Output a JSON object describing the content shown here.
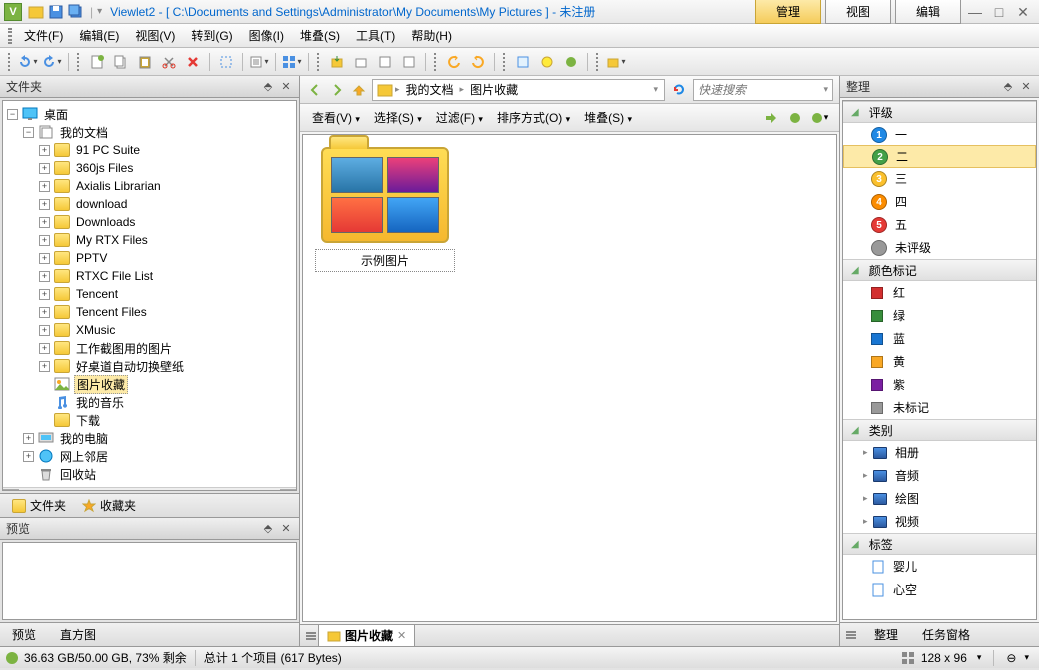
{
  "title": "Viewlet2 - [ C:\\Documents and Settings\\Administrator\\My Documents\\My Pictures ] - 未注册",
  "header_tabs": {
    "manage": "管理",
    "view": "视图",
    "edit": "编辑"
  },
  "menus": {
    "file": "文件(F)",
    "edit": "编辑(E)",
    "view": "视图(V)",
    "goto": "转到(G)",
    "image": "图像(I)",
    "stack": "堆叠(S)",
    "tools": "工具(T)",
    "help": "帮助(H)"
  },
  "panels": {
    "folders": "文件夹",
    "preview": "预览",
    "organize": "整理"
  },
  "tree": {
    "root": "桌面",
    "mydocs": "我的文档",
    "children": [
      "91 PC Suite",
      "360js Files",
      "Axialis Librarian",
      "download",
      "Downloads",
      "My RTX Files",
      "PPTV",
      "RTXC File List",
      "Tencent",
      "Tencent Files",
      "XMusic",
      "工作截图用的图片",
      "好桌道自动切换壁纸",
      "图片收藏",
      "我的音乐",
      "下载"
    ],
    "mycomputer": "我的电脑",
    "network": "网上邻居",
    "recycle": "回收站"
  },
  "left_tabs": {
    "folders": "文件夹",
    "favorites": "收藏夹"
  },
  "breadcrumb": {
    "mydocs": "我的文档",
    "pictures": "图片收藏"
  },
  "search_placeholder": "快速搜索",
  "view_menu": {
    "view": "查看(V)",
    "select": "选择(S)",
    "filter": "过滤(F)",
    "sort": "排序方式(O)",
    "stack": "堆叠(S)"
  },
  "file_item": "示例图片",
  "organize": {
    "rating": {
      "title": "评级",
      "items": [
        "一",
        "二",
        "三",
        "四",
        "五"
      ],
      "none": "未评级"
    },
    "color": {
      "title": "颜色标记",
      "items": [
        {
          "label": "红",
          "color": "#d32f2f"
        },
        {
          "label": "绿",
          "color": "#388e3c"
        },
        {
          "label": "蓝",
          "color": "#1976d2"
        },
        {
          "label": "黄",
          "color": "#f9a825"
        },
        {
          "label": "紫",
          "color": "#7b1fa2"
        }
      ],
      "none": "未标记"
    },
    "category": {
      "title": "类别",
      "items": [
        "相册",
        "音频",
        "绘图",
        "视频"
      ]
    },
    "tags": {
      "title": "标签",
      "items": [
        "婴儿",
        "心空"
      ]
    }
  },
  "bottom_left_tabs": {
    "preview": "预览",
    "histogram": "直方图"
  },
  "right_bottom_tabs": {
    "organize": "整理",
    "taskpane": "任务窗格"
  },
  "doc_tab": "图片收藏",
  "status": {
    "disk": "36.63 GB/50.00 GB, 73% 剩余",
    "items": "总计 1 个项目 (617 Bytes)",
    "dimensions": "128 x 96"
  },
  "rating_colors": [
    "#1e88e5",
    "#43a047",
    "#fbc02d",
    "#fb8c00",
    "#e53935"
  ]
}
